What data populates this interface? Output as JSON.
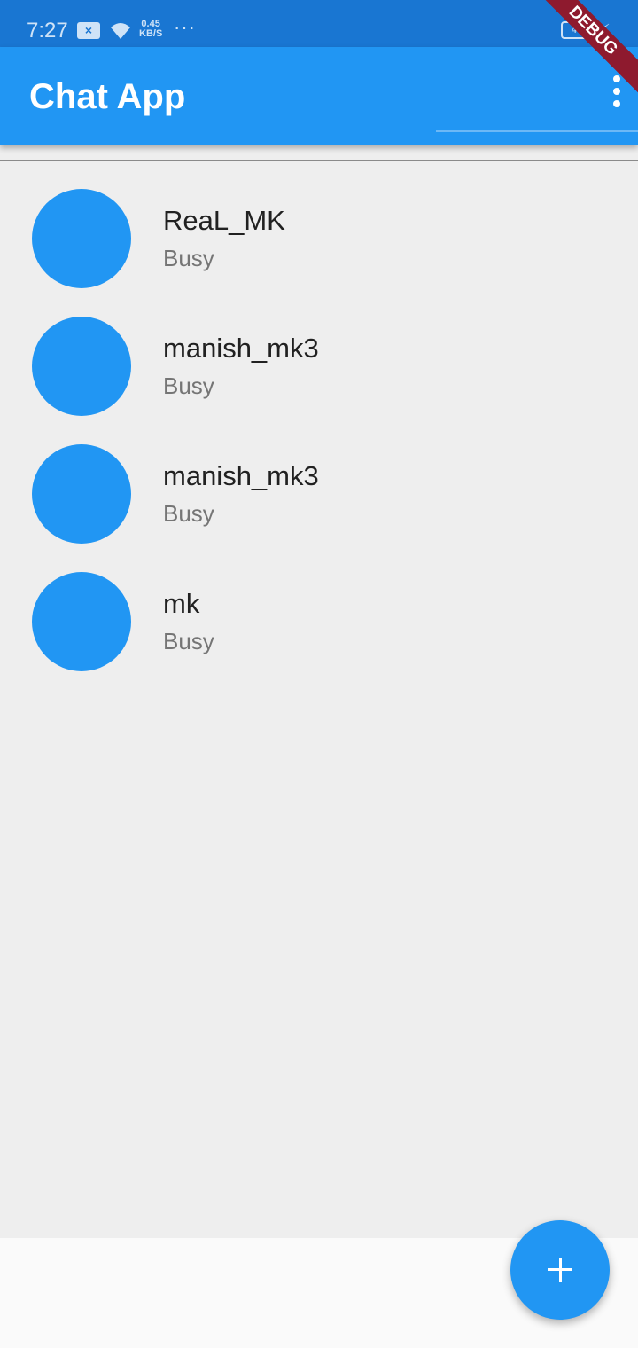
{
  "status_bar": {
    "time": "7:27",
    "sim_icon": "sim-no-service-icon",
    "sim_glyph": "×",
    "wifi_icon": "wifi-icon",
    "net_speed_value": "0.45",
    "net_speed_unit": "KB/S",
    "more": "···",
    "battery_icon": "battery-icon",
    "battery_level": "40",
    "charging_icon": "charging-bolt-icon",
    "charging_glyph": "⚡"
  },
  "debug_banner": "DEBUG",
  "app_bar": {
    "title": "Chat App",
    "menu_icon": "more-vert-icon"
  },
  "chats": [
    {
      "name": "ReaL_MK",
      "status": "Busy"
    },
    {
      "name": "manish_mk3",
      "status": "Busy"
    },
    {
      "name": "manish_mk3",
      "status": "Busy"
    },
    {
      "name": "mk",
      "status": "Busy"
    }
  ],
  "fab": {
    "icon": "add-icon"
  },
  "colors": {
    "primary": "#2196f3",
    "primary_dark": "#1976d2",
    "background": "#eeeeee",
    "debug_banner": "#8e1a2e"
  }
}
